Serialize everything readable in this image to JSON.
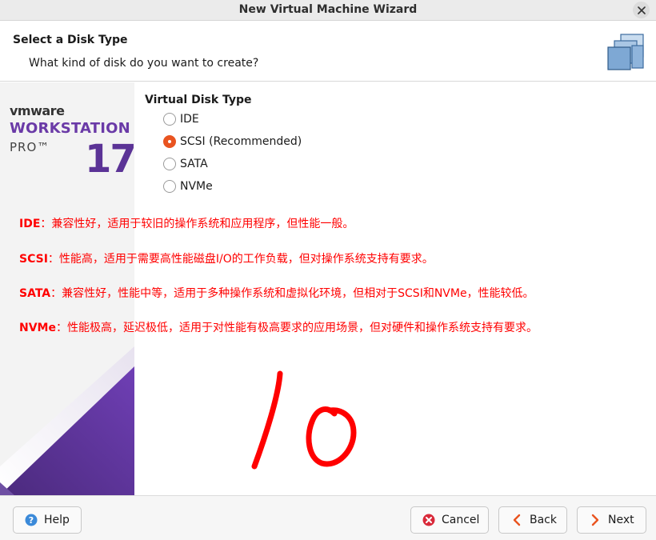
{
  "window": {
    "title": "New Virtual Machine Wizard"
  },
  "header": {
    "title": "Select a Disk Type",
    "subtitle": "What kind of disk do you want to create?"
  },
  "brand": {
    "vendor": "vmware",
    "product": "WORKSTATION",
    "edition": "PRO™",
    "version": "17",
    "accent": "#6a3aa7"
  },
  "disk_type": {
    "label": "Virtual Disk Type",
    "options": [
      {
        "label": "IDE",
        "selected": false
      },
      {
        "label": "SCSI (Recommended)",
        "selected": true
      },
      {
        "label": "SATA",
        "selected": false
      },
      {
        "label": "NVMe",
        "selected": false
      }
    ]
  },
  "annotations": {
    "color": "#ff0000",
    "notes": [
      {
        "term": "IDE",
        "text": "：兼容性好，适用于较旧的操作系统和应用程序，但性能一般。"
      },
      {
        "term": "SCSI",
        "text": "：性能高，适用于需要高性能磁盘I/O的工作负载，但对操作系统支持有要求。"
      },
      {
        "term": "SATA",
        "text": "：兼容性好，性能中等，适用于多种操作系统和虚拟化环境，但相对于SCSI和NVMe，性能较低。"
      },
      {
        "term": "NVMe",
        "text": "：性能极高，延迟极低，适用于对性能有极高要求的应用场景，但对硬件和操作系统支持有要求。"
      }
    ],
    "handwriting": "10"
  },
  "footer": {
    "help": "Help",
    "cancel": "Cancel",
    "back": "Back",
    "next": "Next"
  },
  "icons": {
    "close": "close-icon",
    "help": "help-icon",
    "cancel": "cancel-icon",
    "back": "chevron-left-icon",
    "next": "chevron-right-icon",
    "header": "virtual-disk-icon"
  }
}
